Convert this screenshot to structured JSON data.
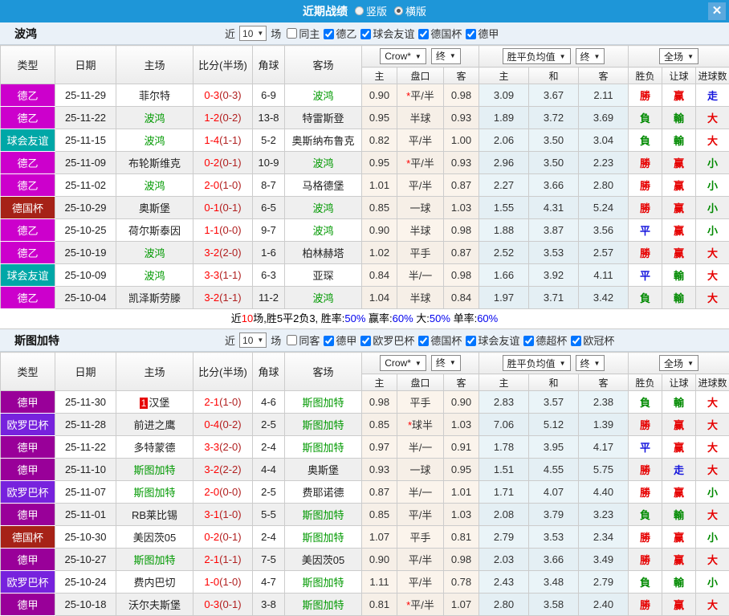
{
  "titlebar": {
    "title": "近期战绩",
    "radios": [
      {
        "label": "竖版",
        "selected": false
      },
      {
        "label": "横版",
        "selected": true
      }
    ],
    "close_glyph": "✕"
  },
  "colors": {
    "titlebar_bg": "#1E96D8",
    "league": {
      "德乙": "#CC00CC",
      "球会友谊": "#00A7A7",
      "德国杯": "#A62217",
      "德甲": "#990099",
      "欧罗巴杯": "#7722DD"
    },
    "char_colors": {
      "勝": "#E60000",
      "平": "#1515DD",
      "負": "#008A00",
      "赢": "#E60000",
      "輸": "#008A00",
      "走": "#1515DD",
      "大": "#E60000",
      "小": "#008A00"
    }
  },
  "columns": {
    "type": "类型",
    "date": "日期",
    "home": "主场",
    "score": "比分(半场)",
    "corner": "角球",
    "away": "客场",
    "sub": [
      "主",
      "盘口",
      "客",
      "主",
      "和",
      "客",
      "胜负",
      "让球",
      "进球数"
    ]
  },
  "sections": [
    {
      "team": "波鸿",
      "filter": {
        "near_label": "近",
        "near_value": "10",
        "unit_label": "场",
        "same": {
          "label": "同主",
          "checked": false
        },
        "leagues": [
          {
            "label": "德乙",
            "checked": true
          },
          {
            "label": "球会友谊",
            "checked": true
          },
          {
            "label": "德国杯",
            "checked": true
          },
          {
            "label": "德甲",
            "checked": true
          }
        ]
      },
      "dropdowns": {
        "bookmaker": "Crow*",
        "final1": "终",
        "europe": "胜平负均值",
        "final2": "终",
        "scope": "全场"
      },
      "rows": [
        {
          "league": "德乙",
          "date": "25-11-29",
          "home": "菲尔特",
          "ht": false,
          "score": "0-3",
          "half": "(0-3)",
          "corner": "6-9",
          "away": "波鸿",
          "at": true,
          "odds": [
            "0.90",
            "*平/半",
            "0.98",
            "3.09",
            "3.67",
            "2.11"
          ],
          "res": [
            "勝",
            "赢",
            "走"
          ]
        },
        {
          "league": "德乙",
          "date": "25-11-22",
          "home": "波鸿",
          "ht": true,
          "score": "1-2",
          "half": "(0-2)",
          "corner": "13-8",
          "away": "特雷斯登",
          "at": false,
          "odds": [
            "0.95",
            "半球",
            "0.93",
            "1.89",
            "3.72",
            "3.69"
          ],
          "res": [
            "負",
            "輸",
            "大"
          ]
        },
        {
          "league": "球会友谊",
          "date": "25-11-15",
          "home": "波鸿",
          "ht": true,
          "score": "1-4",
          "half": "(1-1)",
          "corner": "5-2",
          "away": "奥斯纳布鲁克",
          "at": false,
          "odds": [
            "0.82",
            "平/半",
            "1.00",
            "2.06",
            "3.50",
            "3.04"
          ],
          "res": [
            "負",
            "輸",
            "大"
          ]
        },
        {
          "league": "德乙",
          "date": "25-11-09",
          "home": "布轮斯维克",
          "ht": false,
          "score": "0-2",
          "half": "(0-1)",
          "corner": "10-9",
          "away": "波鸿",
          "at": true,
          "odds": [
            "0.95",
            "*平/半",
            "0.93",
            "2.96",
            "3.50",
            "2.23"
          ],
          "res": [
            "勝",
            "赢",
            "小"
          ]
        },
        {
          "league": "德乙",
          "date": "25-11-02",
          "home": "波鸿",
          "ht": true,
          "score": "2-0",
          "half": "(1-0)",
          "corner": "8-7",
          "away": "马格德堡",
          "at": false,
          "odds": [
            "1.01",
            "平/半",
            "0.87",
            "2.27",
            "3.66",
            "2.80"
          ],
          "res": [
            "勝",
            "赢",
            "小"
          ]
        },
        {
          "league": "德国杯",
          "date": "25-10-29",
          "home": "奥斯堡",
          "ht": false,
          "score": "0-1",
          "half": "(0-1)",
          "corner": "6-5",
          "away": "波鸿",
          "at": true,
          "odds": [
            "0.85",
            "一球",
            "1.03",
            "1.55",
            "4.31",
            "5.24"
          ],
          "res": [
            "勝",
            "赢",
            "小"
          ]
        },
        {
          "league": "德乙",
          "date": "25-10-25",
          "home": "荷尔斯泰因",
          "ht": false,
          "score": "1-1",
          "half": "(0-0)",
          "corner": "9-7",
          "away": "波鸿",
          "at": true,
          "odds": [
            "0.90",
            "半球",
            "0.98",
            "1.88",
            "3.87",
            "3.56"
          ],
          "res": [
            "平",
            "赢",
            "小"
          ]
        },
        {
          "league": "德乙",
          "date": "25-10-19",
          "home": "波鸿",
          "ht": true,
          "score": "3-2",
          "half": "(2-0)",
          "corner": "1-6",
          "away": "柏林赫塔",
          "at": false,
          "odds": [
            "1.02",
            "平手",
            "0.87",
            "2.52",
            "3.53",
            "2.57"
          ],
          "res": [
            "勝",
            "赢",
            "大"
          ]
        },
        {
          "league": "球会友谊",
          "date": "25-10-09",
          "home": "波鸿",
          "ht": true,
          "score": "3-3",
          "half": "(1-1)",
          "corner": "6-3",
          "away": "亚琛",
          "at": false,
          "odds": [
            "0.84",
            "半/一",
            "0.98",
            "1.66",
            "3.92",
            "4.11"
          ],
          "res": [
            "平",
            "輸",
            "大"
          ]
        },
        {
          "league": "德乙",
          "date": "25-10-04",
          "home": "凯泽斯劳滕",
          "ht": false,
          "score": "3-2",
          "half": "(1-1)",
          "corner": "11-2",
          "away": "波鸿",
          "at": true,
          "odds": [
            "1.04",
            "半球",
            "0.84",
            "1.97",
            "3.71",
            "3.42"
          ],
          "res": [
            "負",
            "輸",
            "大"
          ]
        }
      ],
      "summary": [
        {
          "t": "近",
          "c": "k"
        },
        {
          "t": "10",
          "c": "r"
        },
        {
          "t": "场,胜5平2负3, 胜率:",
          "c": "k"
        },
        {
          "t": "50%",
          "c": "b"
        },
        {
          "t": " 赢率:",
          "c": "k"
        },
        {
          "t": "60%",
          "c": "b"
        },
        {
          "t": " 大:",
          "c": "k"
        },
        {
          "t": "50%",
          "c": "b"
        },
        {
          "t": " 单率:",
          "c": "k"
        },
        {
          "t": "60%",
          "c": "b"
        }
      ]
    },
    {
      "team": "斯图加特",
      "filter": {
        "near_label": "近",
        "near_value": "10",
        "unit_label": "场",
        "same": {
          "label": "同客",
          "checked": false
        },
        "leagues": [
          {
            "label": "德甲",
            "checked": true
          },
          {
            "label": "欧罗巴杯",
            "checked": true
          },
          {
            "label": "德国杯",
            "checked": true
          },
          {
            "label": "球会友谊",
            "checked": true
          },
          {
            "label": "德超杯",
            "checked": true
          },
          {
            "label": "欧冠杯",
            "checked": true
          }
        ]
      },
      "dropdowns": {
        "bookmaker": "Crow*",
        "final1": "终",
        "europe": "胜平负均值",
        "final2": "终",
        "scope": "全场"
      },
      "rows": [
        {
          "league": "德甲",
          "date": "25-11-30",
          "home": "汉堡",
          "badge": "1",
          "ht": false,
          "score": "2-1",
          "half": "(1-0)",
          "corner": "4-6",
          "away": "斯图加特",
          "at": true,
          "odds": [
            "0.98",
            "平手",
            "0.90",
            "2.83",
            "3.57",
            "2.38"
          ],
          "res": [
            "負",
            "輸",
            "大"
          ]
        },
        {
          "league": "欧罗巴杯",
          "date": "25-11-28",
          "home": "前进之鹰",
          "ht": false,
          "score": "0-4",
          "half": "(0-2)",
          "corner": "2-5",
          "away": "斯图加特",
          "at": true,
          "odds": [
            "0.85",
            "*球半",
            "1.03",
            "7.06",
            "5.12",
            "1.39"
          ],
          "res": [
            "勝",
            "赢",
            "大"
          ]
        },
        {
          "league": "德甲",
          "date": "25-11-22",
          "home": "多特蒙德",
          "ht": false,
          "score": "3-3",
          "half": "(2-0)",
          "corner": "2-4",
          "away": "斯图加特",
          "at": true,
          "odds": [
            "0.97",
            "半/一",
            "0.91",
            "1.78",
            "3.95",
            "4.17"
          ],
          "res": [
            "平",
            "赢",
            "大"
          ]
        },
        {
          "league": "德甲",
          "date": "25-11-10",
          "home": "斯图加特",
          "ht": true,
          "score": "3-2",
          "half": "(2-2)",
          "corner": "4-4",
          "away": "奥斯堡",
          "at": false,
          "odds": [
            "0.93",
            "一球",
            "0.95",
            "1.51",
            "4.55",
            "5.75"
          ],
          "res": [
            "勝",
            "走",
            "大"
          ]
        },
        {
          "league": "欧罗巴杯",
          "date": "25-11-07",
          "home": "斯图加特",
          "ht": true,
          "score": "2-0",
          "half": "(0-0)",
          "corner": "2-5",
          "away": "费耶诺德",
          "at": false,
          "odds": [
            "0.87",
            "半/一",
            "1.01",
            "1.71",
            "4.07",
            "4.40"
          ],
          "res": [
            "勝",
            "赢",
            "小"
          ]
        },
        {
          "league": "德甲",
          "date": "25-11-01",
          "home": "RB莱比锡",
          "ht": false,
          "score": "3-1",
          "half": "(1-0)",
          "corner": "5-5",
          "away": "斯图加特",
          "at": true,
          "odds": [
            "0.85",
            "平/半",
            "1.03",
            "2.08",
            "3.79",
            "3.23"
          ],
          "res": [
            "負",
            "輸",
            "大"
          ]
        },
        {
          "league": "德国杯",
          "date": "25-10-30",
          "home": "美因茨05",
          "ht": false,
          "score": "0-2",
          "half": "(0-1)",
          "corner": "2-4",
          "away": "斯图加特",
          "at": true,
          "odds": [
            "1.07",
            "平手",
            "0.81",
            "2.79",
            "3.53",
            "2.34"
          ],
          "res": [
            "勝",
            "赢",
            "小"
          ]
        },
        {
          "league": "德甲",
          "date": "25-10-27",
          "home": "斯图加特",
          "ht": true,
          "score": "2-1",
          "half": "(1-1)",
          "corner": "7-5",
          "away": "美因茨05",
          "at": false,
          "odds": [
            "0.90",
            "平/半",
            "0.98",
            "2.03",
            "3.66",
            "3.49"
          ],
          "res": [
            "勝",
            "赢",
            "大"
          ]
        },
        {
          "league": "欧罗巴杯",
          "date": "25-10-24",
          "home": "费内巴切",
          "ht": false,
          "score": "1-0",
          "half": "(1-0)",
          "corner": "4-7",
          "away": "斯图加特",
          "at": true,
          "odds": [
            "1.11",
            "平/半",
            "0.78",
            "2.43",
            "3.48",
            "2.79"
          ],
          "res": [
            "負",
            "輸",
            "小"
          ]
        },
        {
          "league": "德甲",
          "date": "25-10-18",
          "home": "沃尔夫斯堡",
          "ht": false,
          "score": "0-3",
          "half": "(0-1)",
          "corner": "3-8",
          "away": "斯图加特",
          "at": true,
          "odds": [
            "0.81",
            "*平/半",
            "1.07",
            "2.80",
            "3.58",
            "2.40"
          ],
          "res": [
            "勝",
            "赢",
            "大"
          ]
        }
      ],
      "summary": null
    }
  ]
}
